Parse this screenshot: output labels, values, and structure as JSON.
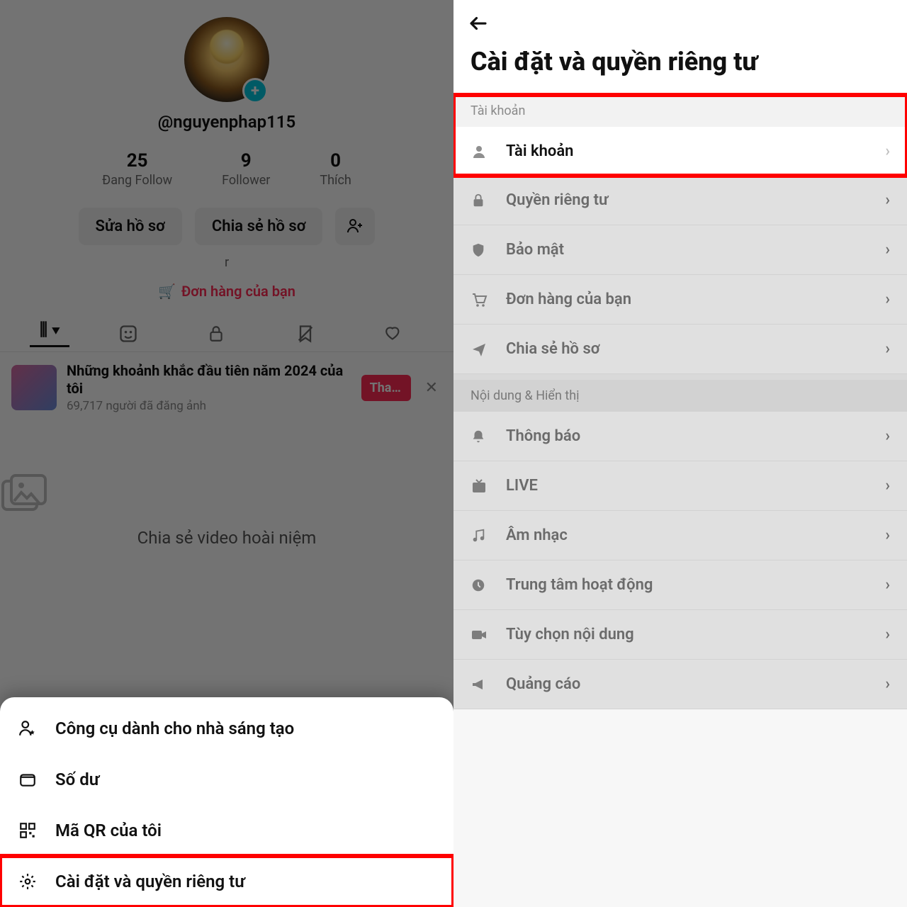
{
  "left": {
    "username": "@nguyenphap115",
    "stats": {
      "following": {
        "num": "25",
        "label": "Đang Follow"
      },
      "followers": {
        "num": "9",
        "label": "Follower"
      },
      "likes": {
        "num": "0",
        "label": "Thích"
      }
    },
    "buttons": {
      "edit": "Sửa hồ sơ",
      "share": "Chia sẻ hồ sơ"
    },
    "small_text": "r",
    "orders": "Đơn hàng của bạn",
    "trend": {
      "title": "Những khoảnh khắc đầu tiên năm 2024 của tôi",
      "subtitle": "69,717 người đã đăng ảnh",
      "badge": "Tha..."
    },
    "empty_caption": "Chia sẻ video hoài niệm",
    "sheet": {
      "creator": "Công cụ dành cho nhà sáng tạo",
      "balance": "Số dư",
      "qr": "Mã QR của tôi",
      "settings": "Cài đặt và quyền riêng tư"
    }
  },
  "right": {
    "title": "Cài đặt và quyền riêng tư",
    "section1": "Tài khoản",
    "rows1": {
      "account": "Tài khoản",
      "privacy": "Quyền riêng tư",
      "security": "Bảo mật",
      "orders": "Đơn hàng của bạn",
      "share": "Chia sẻ hồ sơ"
    },
    "section2": "Nội dung & Hiển thị",
    "rows2": {
      "notify": "Thông báo",
      "live": "LIVE",
      "music": "Âm nhạc",
      "activity": "Trung tâm hoạt động",
      "content": "Tùy chọn nội dung",
      "ads": "Quảng cáo"
    }
  }
}
